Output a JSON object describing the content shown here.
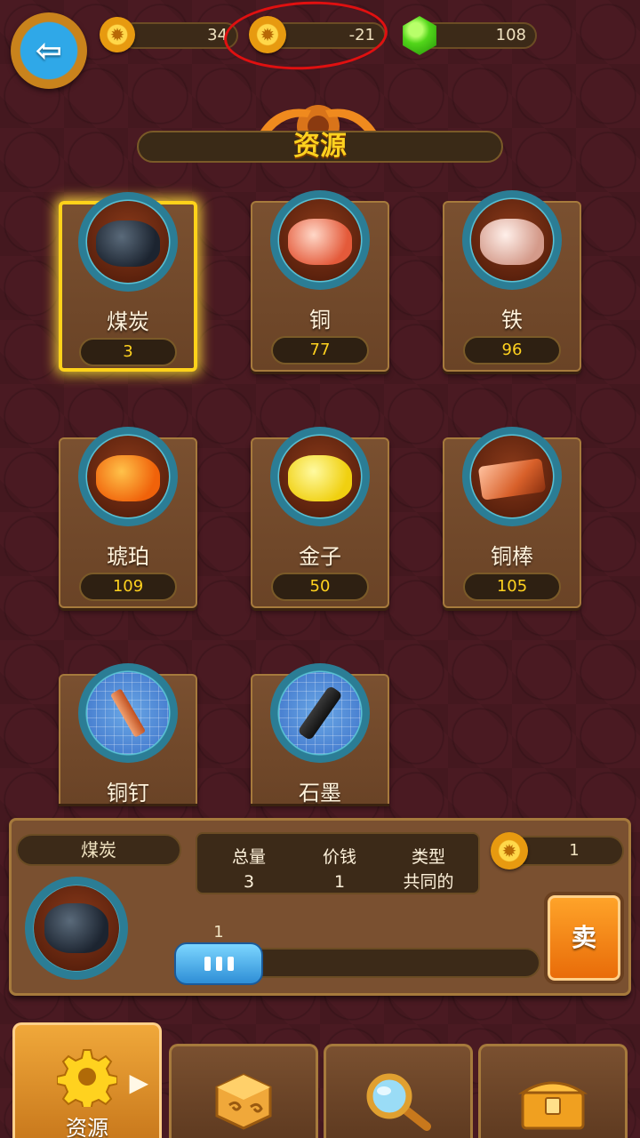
{
  "top_bar": {
    "gears_value": "34",
    "coins_value": "-21",
    "gems_value": "108"
  },
  "title": "资源",
  "resources": [
    {
      "name": "煤炭",
      "count": "3",
      "icon": "coal-icon",
      "selected": true
    },
    {
      "name": "铜",
      "count": "77",
      "icon": "copper-ore-icon"
    },
    {
      "name": "铁",
      "count": "96",
      "icon": "iron-ore-icon"
    },
    {
      "name": "琥珀",
      "count": "109",
      "icon": "amber-icon"
    },
    {
      "name": "金子",
      "count": "50",
      "icon": "gold-nugget-icon"
    },
    {
      "name": "铜棒",
      "count": "105",
      "icon": "copper-bar-icon"
    },
    {
      "name": "铜钉",
      "icon": "copper-nail-icon"
    },
    {
      "name": "石墨",
      "icon": "graphite-icon"
    }
  ],
  "detail": {
    "selected_name": "煤炭",
    "total_label": "总量",
    "total_value": "3",
    "price_label": "价钱",
    "price_value": "1",
    "type_label": "类型",
    "type_value": "共同的",
    "sell_price": "1",
    "slider_value": "1",
    "sell_label": "卖"
  },
  "nav": {
    "resources_label": "资源"
  },
  "colors": {
    "accent_gold": "#ffd21f",
    "annotation_red": "#e01010",
    "background": "#4a1a22"
  }
}
